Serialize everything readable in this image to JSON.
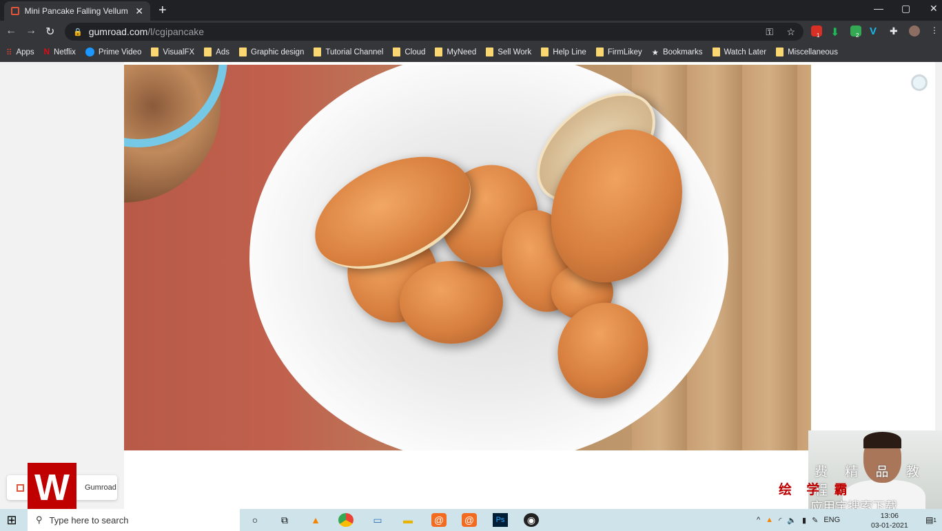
{
  "browser": {
    "tab_title": "Mini Pancake Falling Vellum FX | G",
    "url_domain": "gumroad.com",
    "url_path": "/l/cgipancake",
    "extension_badges": [
      "1",
      "2"
    ],
    "bookmarks": [
      "Apps",
      "Netflix",
      "Prime Video",
      "VisualFX",
      "Ads",
      "Graphic design",
      "Tutorial Channel",
      "Cloud",
      "MyNeed",
      "Sell Work",
      "Help Line",
      "FirmLikey",
      "Bookmarks",
      "Watch Later",
      "Miscellaneous"
    ]
  },
  "download": {
    "label": "Gumroad"
  },
  "overlay": {
    "line1": "费 精 品 教 程",
    "line2": "绘 学 霸",
    "line3": "应用宝搜索下载"
  },
  "taskbar": {
    "search_placeholder": "Type here to search",
    "lang": "ENG",
    "time": "13:06",
    "date": "03-01-2021",
    "notif_count": "1"
  },
  "colors": {
    "accent": "#c00000",
    "chrome_dark": "#202124"
  }
}
